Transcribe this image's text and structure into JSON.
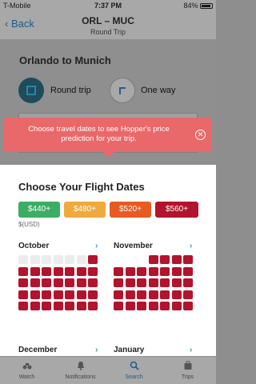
{
  "status_bar": {
    "carrier": "T-Mobile",
    "time": "7:37 PM",
    "battery": "84%"
  },
  "nav": {
    "back_label": "Back",
    "title": "ORL – MUC",
    "subtitle": "Round Trip"
  },
  "background": {
    "route": "Orlando to Munich",
    "round_trip_label": "Round trip",
    "one_way_label": "One way"
  },
  "tooltip": {
    "message": "Choose travel dates to see Hopper's price prediction for your trip."
  },
  "sheet": {
    "heading": "Choose Your Flight Dates",
    "currency": "$(USD)",
    "legend": [
      {
        "label": "$440+",
        "color": "#3aae63"
      },
      {
        "label": "$480+",
        "color": "#f0a93b"
      },
      {
        "label": "$520+",
        "color": "#e85a22"
      },
      {
        "label": "$560+",
        "color": "#b3132c"
      }
    ],
    "months": [
      {
        "name": "October",
        "leading_blank": 0,
        "greyed_days": 6
      },
      {
        "name": "November",
        "leading_blank": 3,
        "greyed_days": 0
      },
      {
        "name": "December"
      },
      {
        "name": "January"
      }
    ]
  },
  "tabbar": {
    "items": [
      {
        "label": "Watch",
        "icon": "binoculars-icon",
        "active": false
      },
      {
        "label": "Notifications",
        "icon": "bell-icon",
        "active": false
      },
      {
        "label": "Search",
        "icon": "search-icon",
        "active": true
      },
      {
        "label": "Trips",
        "icon": "suitcase-icon",
        "active": false
      }
    ]
  }
}
